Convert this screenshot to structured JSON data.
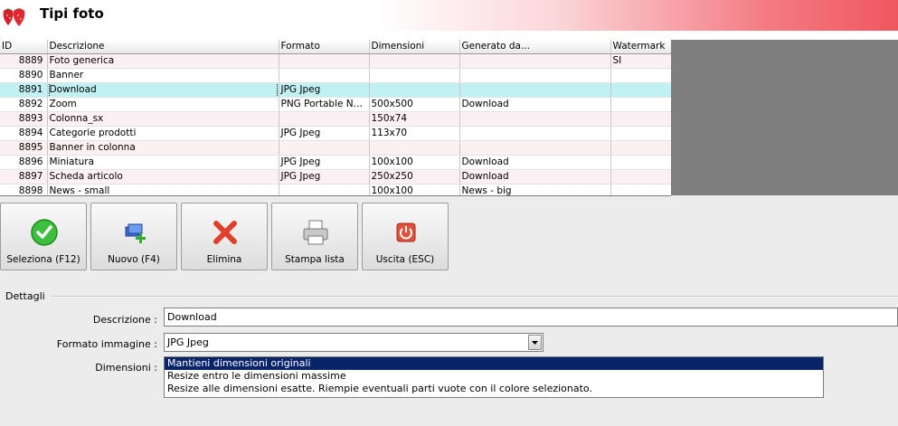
{
  "window": {
    "title": "Tipi foto"
  },
  "colors": {
    "selected_row": "#c2f1f3",
    "odd_row": "#fdf0f2",
    "list_selection": "#0a246a"
  },
  "grid": {
    "columns": [
      "ID",
      "Descrizione",
      "Formato",
      "Dimensioni",
      "Generato da...",
      "Watermark"
    ],
    "rows": [
      {
        "id": "8889",
        "descr": "Foto generica",
        "formato": "",
        "dim": "",
        "gen": "",
        "wm": "SI"
      },
      {
        "id": "8890",
        "descr": "Banner",
        "formato": "",
        "dim": "",
        "gen": "",
        "wm": ""
      },
      {
        "id": "8891",
        "descr": "Download",
        "formato": "JPG Jpeg",
        "dim": "",
        "gen": "",
        "wm": ""
      },
      {
        "id": "8892",
        "descr": "Zoom",
        "formato": "PNG Portable Ne...",
        "dim": "500x500",
        "gen": "Download",
        "wm": ""
      },
      {
        "id": "8893",
        "descr": "Colonna_sx",
        "formato": "",
        "dim": "150x74",
        "gen": "",
        "wm": ""
      },
      {
        "id": "8894",
        "descr": "Categorie prodotti",
        "formato": "JPG Jpeg",
        "dim": "113x70",
        "gen": "",
        "wm": ""
      },
      {
        "id": "8895",
        "descr": "Banner in colonna",
        "formato": "",
        "dim": "",
        "gen": "",
        "wm": ""
      },
      {
        "id": "8896",
        "descr": "Miniatura",
        "formato": "JPG Jpeg",
        "dim": "100x100",
        "gen": "Download",
        "wm": ""
      },
      {
        "id": "8897",
        "descr": "Scheda articolo",
        "formato": "JPG Jpeg",
        "dim": "250x250",
        "gen": "Download",
        "wm": ""
      },
      {
        "id": "8898",
        "descr": "News - small",
        "formato": "",
        "dim": "100x100",
        "gen": "News - big",
        "wm": ""
      }
    ]
  },
  "toolbar": {
    "select_label": "Seleziona (F12)",
    "new_label": "Nuovo (F4)",
    "delete_label": "Elimina",
    "print_label": "Stampa lista",
    "exit_label": "Uscita (ESC)"
  },
  "details": {
    "section_label": "Dettagli",
    "descr_label": "Descrizione :",
    "descr_value": "Download",
    "format_label": "Formato immagine :",
    "format_value": "JPG Jpeg",
    "dim_label": "Dimensioni :",
    "dim_options": [
      "Mantieni dimensioni originali",
      "Resize entro le dimensioni massime",
      "Resize alle dimensioni esatte. Riempie eventuali parti vuote con il colore selezionato."
    ]
  }
}
